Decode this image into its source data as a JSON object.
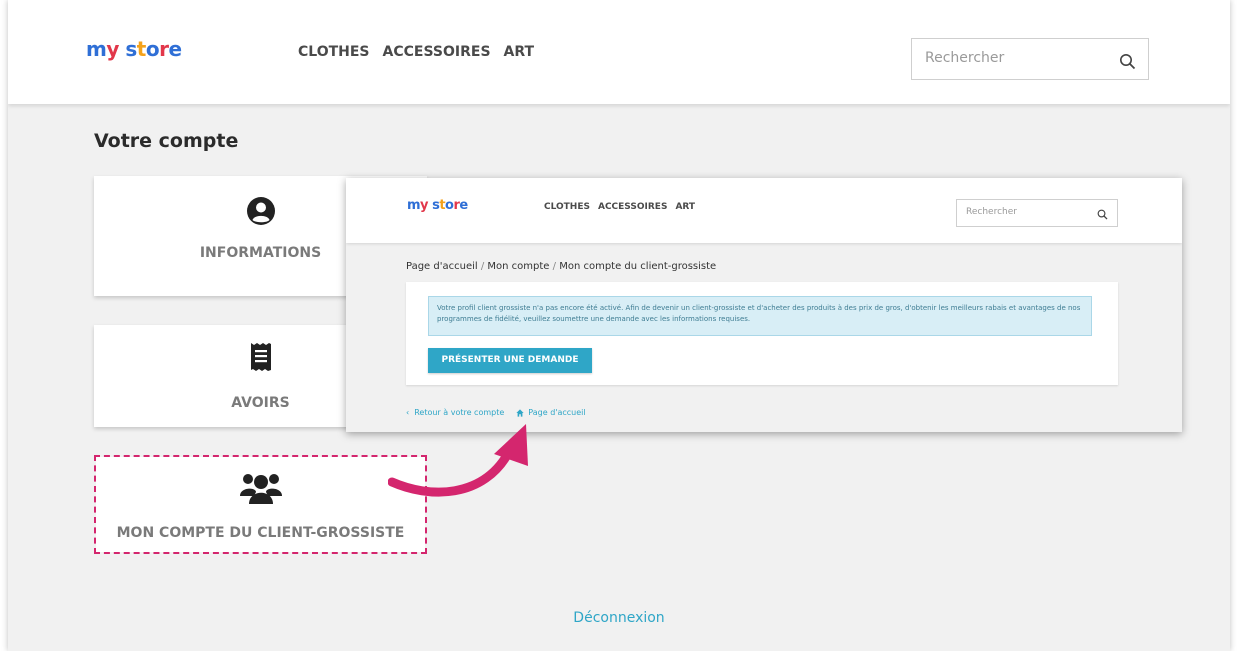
{
  "brand": {
    "logo_text": "my store"
  },
  "nav": [
    "CLOTHES",
    "ACCESSOIRES",
    "ART"
  ],
  "search": {
    "placeholder": "Rechercher"
  },
  "page_title": "Votre compte",
  "tiles": {
    "informations": "INFORMATIONS",
    "avoirs": "AVOIRS",
    "wholesale": "MON COMPTE DU CLIENT-GROSSISTE"
  },
  "logout": "Déconnexion",
  "overlay": {
    "nav": [
      "CLOTHES",
      "ACCESSOIRES",
      "ART"
    ],
    "search_placeholder": "Rechercher",
    "breadcrumb": [
      "Page d'accueil",
      "Mon compte",
      "Mon compte du client-grossiste"
    ],
    "alert_text": "Votre profil client grossiste n'a pas encore été activé. Afin de devenir un client-grossiste et d'acheter des produits à des prix de gros, d'obtenir les meilleurs rabais et avantages de nos programmes de fidélité, veuillez soumettre une demande avec les informations requises.",
    "request_button": "PRÉSENTER UNE DEMANDE",
    "back_link": "Retour à votre compte",
    "home_link": "Page d'accueil"
  },
  "colors": {
    "accent": "#2fa6c7",
    "highlight": "#d4266e",
    "background": "#f1f1f1"
  },
  "icons": [
    "user-circle-icon",
    "receipt-icon",
    "users-group-icon",
    "search-icon",
    "home-icon",
    "chevron-left-icon",
    "curved-arrow-icon"
  ]
}
